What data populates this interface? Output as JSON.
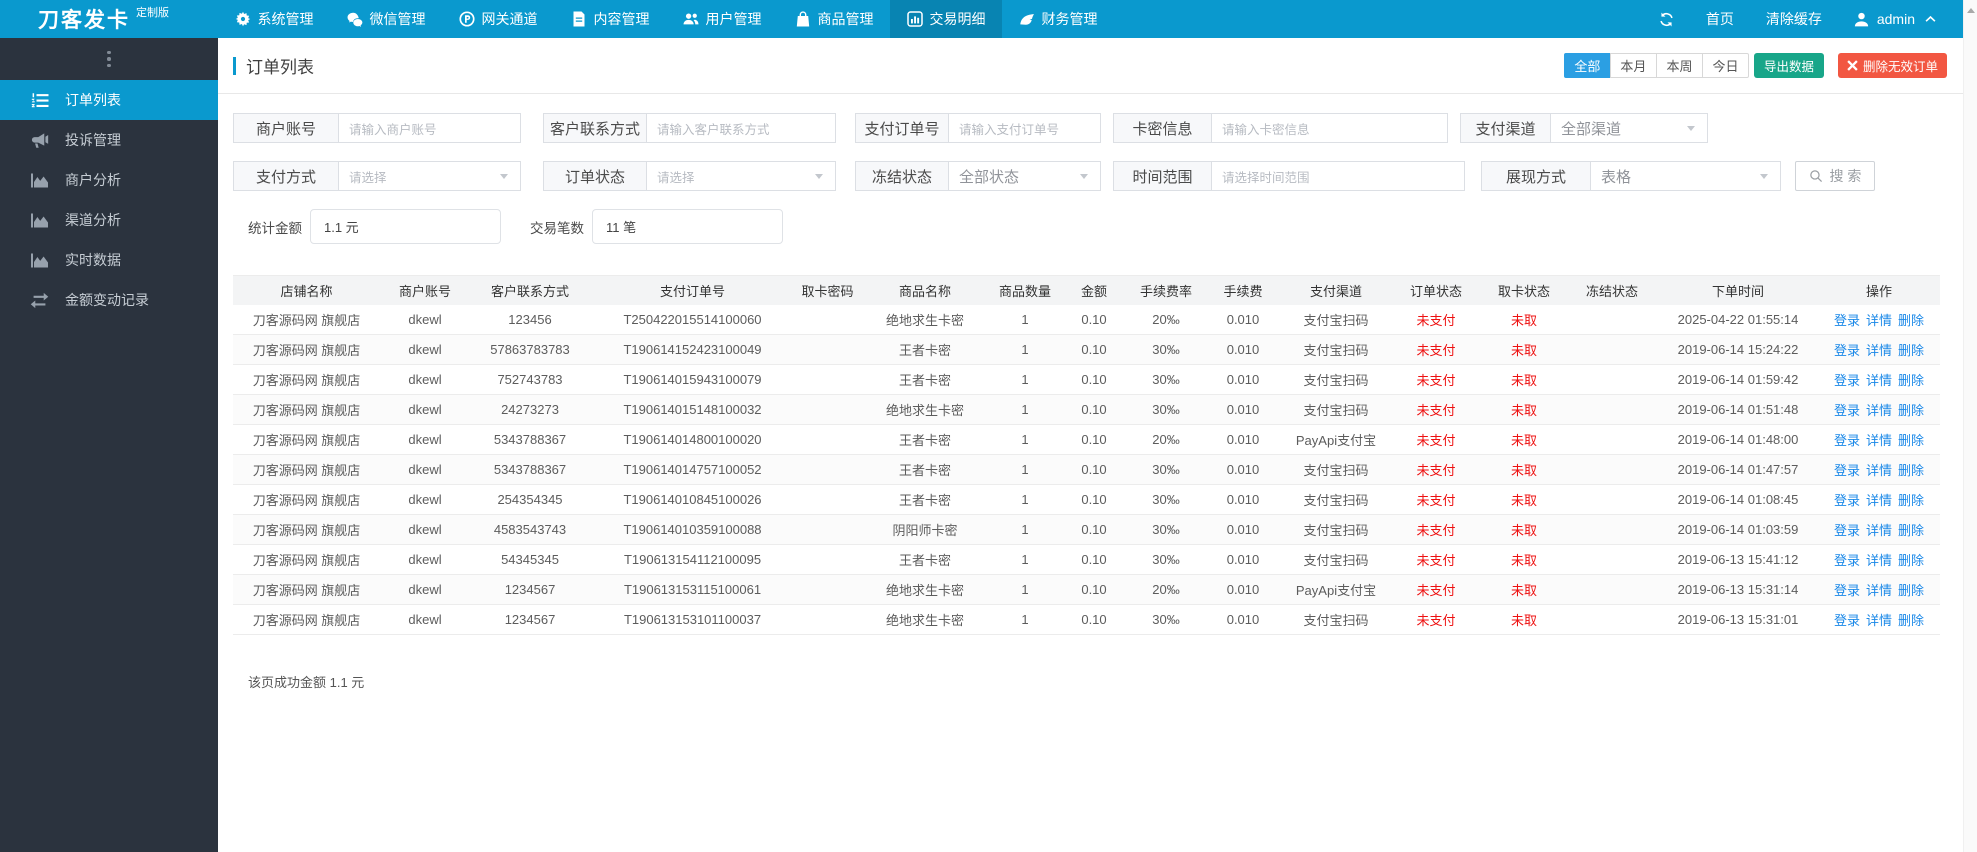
{
  "topbar": {
    "logo": "刀客发卡",
    "logo_badge": "定制版",
    "nav": [
      {
        "label": "系统管理",
        "icon": "gear-icon",
        "active": false
      },
      {
        "label": "微信管理",
        "icon": "wechat-icon",
        "active": false
      },
      {
        "label": "网关通道",
        "icon": "gateway-icon",
        "active": false
      },
      {
        "label": "内容管理",
        "icon": "document-icon",
        "active": false
      },
      {
        "label": "用户管理",
        "icon": "users-icon",
        "active": false
      },
      {
        "label": "商品管理",
        "icon": "bag-icon",
        "active": false
      },
      {
        "label": "交易明细",
        "icon": "chart-icon",
        "active": true
      },
      {
        "label": "财务管理",
        "icon": "finance-icon",
        "active": false
      }
    ],
    "right": {
      "home": "首页",
      "clear_cache": "清除缓存",
      "user": "admin"
    }
  },
  "sidebar": {
    "items": [
      {
        "label": "订单列表",
        "icon": "list-ordered-icon",
        "active": true
      },
      {
        "label": "投诉管理",
        "icon": "megaphone-icon",
        "active": false
      },
      {
        "label": "商户分析",
        "icon": "area-chart-icon",
        "active": false
      },
      {
        "label": "渠道分析",
        "icon": "area-chart-icon",
        "active": false
      },
      {
        "label": "实时数据",
        "icon": "area-chart-icon",
        "active": false
      },
      {
        "label": "金额变动记录",
        "icon": "swap-icon",
        "active": false
      }
    ]
  },
  "page": {
    "title": "订单列表",
    "range_buttons": [
      "全部",
      "本月",
      "本周",
      "今日"
    ],
    "active_range": "全部",
    "export_label": "导出数据",
    "delete_invalid_label": "删除无效订单"
  },
  "filters": {
    "row1": [
      {
        "label": "商户账号",
        "type": "input",
        "placeholder": "请输入商户账号"
      },
      {
        "label": "客户联系方式",
        "type": "input",
        "placeholder": "请输入客户联系方式"
      },
      {
        "label": "支付订单号",
        "type": "input",
        "placeholder": "请输入支付订单号"
      },
      {
        "label": "卡密信息",
        "type": "input",
        "placeholder": "请输入卡密信息"
      },
      {
        "label": "支付渠道",
        "type": "select",
        "value": "全部渠道",
        "is_placeholder": false
      }
    ],
    "row2": [
      {
        "label": "支付方式",
        "type": "select",
        "value": "请选择",
        "is_placeholder": true
      },
      {
        "label": "订单状态",
        "type": "select",
        "value": "请选择",
        "is_placeholder": true
      },
      {
        "label": "冻结状态",
        "type": "select",
        "value": "全部状态",
        "is_placeholder": false
      },
      {
        "label": "时间范围",
        "type": "input",
        "placeholder": "请选择时间范围"
      },
      {
        "label": "展现方式",
        "type": "select",
        "value": "表格",
        "is_placeholder": false
      }
    ],
    "search_label": "搜 索",
    "stats": [
      {
        "label": "统计金额",
        "value": "1.1 元"
      },
      {
        "label": "交易笔数",
        "value": "11 笔"
      }
    ]
  },
  "table": {
    "headers": [
      "店铺名称",
      "商户账号",
      "客户联系方式",
      "支付订单号",
      "取卡密码",
      "商品名称",
      "商品数量",
      "金额",
      "手续费率",
      "手续费",
      "支付渠道",
      "订单状态",
      "取卡状态",
      "冻结状态",
      "下单时间",
      "操作"
    ],
    "row_actions": [
      "登录",
      "详情",
      "删除"
    ],
    "rows": [
      [
        "刀客源码网 旗舰店",
        "dkewl",
        "123456",
        "T250422015514100060",
        "",
        "绝地求生卡密",
        "1",
        "0.10",
        "20‰",
        "0.010",
        "支付宝扫码",
        "未支付",
        "未取",
        "",
        "2025-04-22 01:55:14"
      ],
      [
        "刀客源码网 旗舰店",
        "dkewl",
        "57863783783",
        "T190614152423100049",
        "",
        "王者卡密",
        "1",
        "0.10",
        "30‰",
        "0.010",
        "支付宝扫码",
        "未支付",
        "未取",
        "",
        "2019-06-14 15:24:22"
      ],
      [
        "刀客源码网 旗舰店",
        "dkewl",
        "752743783",
        "T190614015943100079",
        "",
        "王者卡密",
        "1",
        "0.10",
        "30‰",
        "0.010",
        "支付宝扫码",
        "未支付",
        "未取",
        "",
        "2019-06-14 01:59:42"
      ],
      [
        "刀客源码网 旗舰店",
        "dkewl",
        "24273273",
        "T190614015148100032",
        "",
        "绝地求生卡密",
        "1",
        "0.10",
        "30‰",
        "0.010",
        "支付宝扫码",
        "未支付",
        "未取",
        "",
        "2019-06-14 01:51:48"
      ],
      [
        "刀客源码网 旗舰店",
        "dkewl",
        "5343788367",
        "T190614014800100020",
        "",
        "王者卡密",
        "1",
        "0.10",
        "20‰",
        "0.010",
        "PayApi支付宝",
        "未支付",
        "未取",
        "",
        "2019-06-14 01:48:00"
      ],
      [
        "刀客源码网 旗舰店",
        "dkewl",
        "5343788367",
        "T190614014757100052",
        "",
        "王者卡密",
        "1",
        "0.10",
        "30‰",
        "0.010",
        "支付宝扫码",
        "未支付",
        "未取",
        "",
        "2019-06-14 01:47:57"
      ],
      [
        "刀客源码网 旗舰店",
        "dkewl",
        "254354345",
        "T190614010845100026",
        "",
        "王者卡密",
        "1",
        "0.10",
        "30‰",
        "0.010",
        "支付宝扫码",
        "未支付",
        "未取",
        "",
        "2019-06-14 01:08:45"
      ],
      [
        "刀客源码网 旗舰店",
        "dkewl",
        "4583543743",
        "T190614010359100088",
        "",
        "阴阳师卡密",
        "1",
        "0.10",
        "30‰",
        "0.010",
        "支付宝扫码",
        "未支付",
        "未取",
        "",
        "2019-06-14 01:03:59"
      ],
      [
        "刀客源码网 旗舰店",
        "dkewl",
        "54345345",
        "T190613154112100095",
        "",
        "王者卡密",
        "1",
        "0.10",
        "30‰",
        "0.010",
        "支付宝扫码",
        "未支付",
        "未取",
        "",
        "2019-06-13 15:41:12"
      ],
      [
        "刀客源码网 旗舰店",
        "dkewl",
        "1234567",
        "T190613153115100061",
        "",
        "绝地求生卡密",
        "1",
        "0.10",
        "20‰",
        "0.010",
        "PayApi支付宝",
        "未支付",
        "未取",
        "",
        "2019-06-13 15:31:14"
      ],
      [
        "刀客源码网 旗舰店",
        "dkewl",
        "1234567",
        "T190613153101100037",
        "",
        "绝地求生卡密",
        "1",
        "0.10",
        "30‰",
        "0.010",
        "支付宝扫码",
        "未支付",
        "未取",
        "",
        "2019-06-13 15:31:01"
      ]
    ]
  },
  "footer": {
    "summary": "该页成功金额 1.1 元"
  }
}
